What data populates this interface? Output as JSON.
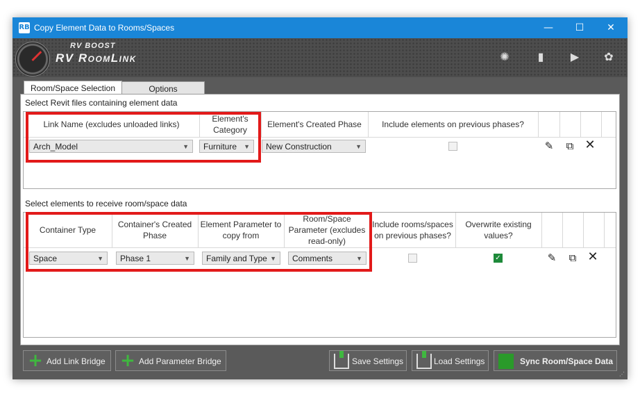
{
  "window": {
    "app_icon": "RB",
    "title": "Copy Element Data to Rooms/Spaces",
    "controls": {
      "minimize": "—",
      "maximize": "☐",
      "close": "✕"
    }
  },
  "header": {
    "brand_small": "RV BOOST",
    "brand_big": "RV RoomLink",
    "icons": [
      "lightbulb-icon",
      "info-icon",
      "video-icon",
      "settings-icon"
    ]
  },
  "tabs": [
    {
      "label": "Room/Space Selection",
      "active": true
    },
    {
      "label": "Options",
      "active": false
    }
  ],
  "link_section": {
    "label": "Select Revit files containing element data",
    "columns": [
      "Link Name (excludes unloaded links)",
      "Element's Category",
      "Element's Created Phase",
      "Include elements on previous phases?"
    ],
    "row": {
      "link_name": "Arch_Model",
      "category": "Furniture",
      "phase": "New Construction",
      "include_previous": false
    }
  },
  "param_section": {
    "label": "Select elements to receive room/space data",
    "columns": [
      "Container Type",
      "Container's Created Phase",
      "Element Parameter to copy from",
      "Room/Space Parameter (excludes read-only)",
      "Include rooms/spaces on previous phases?",
      "Overwrite existing values?"
    ],
    "row": {
      "container_type": "Space",
      "container_phase": "Phase 1",
      "element_param": "Family and Type",
      "room_param": "Comments",
      "include_previous": false,
      "overwrite": true
    }
  },
  "buttons": {
    "add_link": "Add Link Bridge",
    "add_param": "Add Parameter Bridge",
    "save": "Save Settings",
    "load": "Load Settings",
    "sync": "Sync Room/Space Data"
  },
  "colors": {
    "titlebar": "#1a86d8",
    "highlight": "#e21a1a",
    "checkbox_on": "#1e8a3a",
    "add_icon": "#3fb83f"
  }
}
